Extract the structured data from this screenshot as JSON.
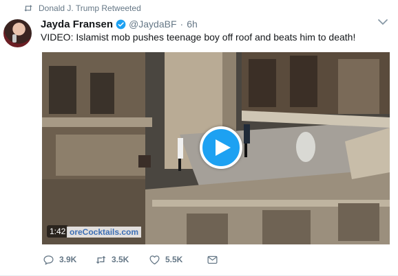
{
  "retweet_context": {
    "text": "Donald J. Trump Retweeted",
    "icon": "retweet-icon"
  },
  "author": {
    "name": "Jayda Fransen",
    "verified": true,
    "handle": "@JaydaBF",
    "separator": "·",
    "time": "6h"
  },
  "tweet": {
    "text": "VIDEO: Islamist mob pushes teenage boy off roof and beats him to death!"
  },
  "video": {
    "duration": "1:42",
    "watermark": "oreCocktails.com",
    "play_icon": "play-icon"
  },
  "actions": {
    "reply_count": "3.9K",
    "retweet_count": "3.5K",
    "like_count": "5.5K",
    "icons": [
      "reply-icon",
      "retweet-icon",
      "like-icon",
      "message-icon"
    ]
  },
  "colors": {
    "accent": "#1da1f2",
    "secondary_text": "#657786",
    "primary_text": "#14171a"
  }
}
